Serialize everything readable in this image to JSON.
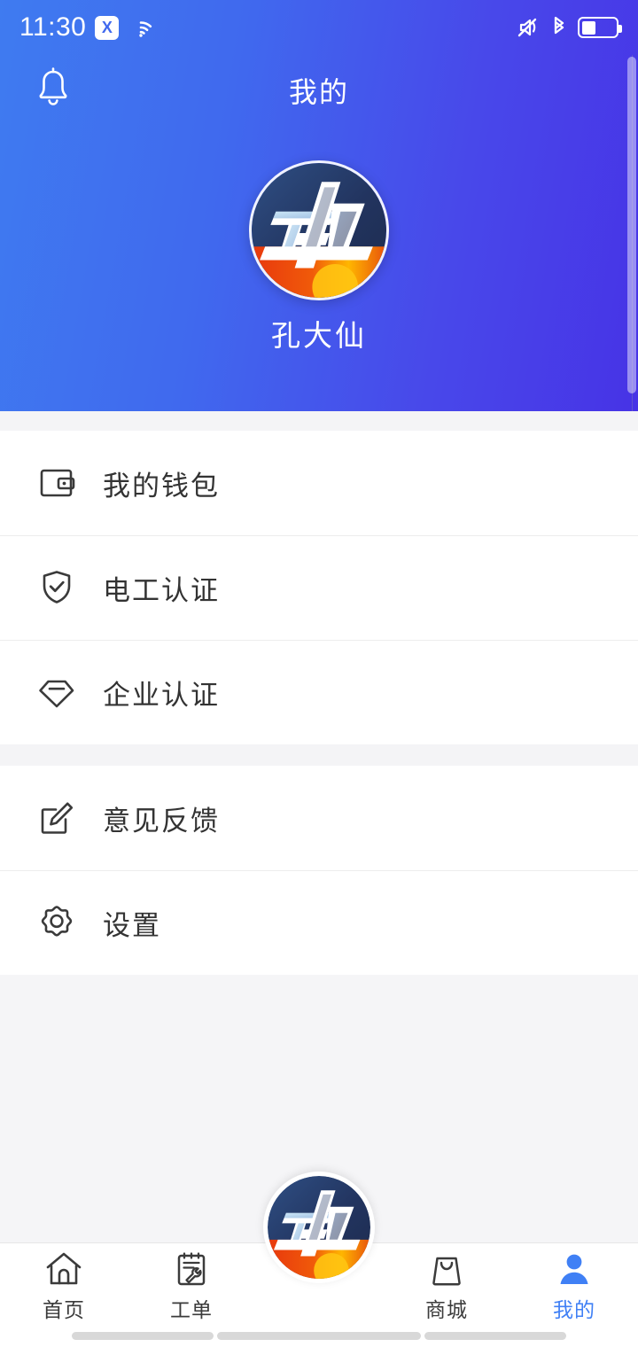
{
  "statusbar": {
    "time": "11:30",
    "badge_label": "X",
    "icons": [
      "x-badge-icon",
      "wifi-icon",
      "mute-icon",
      "bluetooth-icon",
      "battery-icon"
    ],
    "battery_level_pct": 42
  },
  "header": {
    "title": "我的",
    "bell_icon": "bell-icon",
    "gradient_from": "#3f7bf0",
    "gradient_to": "#4733e6"
  },
  "profile": {
    "username": "孔大仙",
    "avatar_icon": "app-logo-avatar"
  },
  "menu": {
    "group_one": [
      {
        "label": "我的钱包",
        "icon": "wallet-icon"
      },
      {
        "label": "电工认证",
        "icon": "shield-check-icon"
      },
      {
        "label": "企业认证",
        "icon": "diamond-icon"
      }
    ],
    "group_two": [
      {
        "label": "意见反馈",
        "icon": "edit-pencil-icon"
      },
      {
        "label": "设置",
        "icon": "gear-icon"
      }
    ]
  },
  "tabbar": {
    "active_color": "#4080f5",
    "inactive_color": "#3b3b3b",
    "tabs": [
      {
        "label": "首页",
        "icon": "home-icon",
        "active": false
      },
      {
        "label": "工单",
        "icon": "clipboard-wrench-icon",
        "active": false
      },
      {
        "label": "商城",
        "icon": "shopping-bag-icon",
        "active": false
      },
      {
        "label": "我的",
        "icon": "person-icon",
        "active": true
      }
    ],
    "center_button_icon": "app-logo-fab"
  }
}
